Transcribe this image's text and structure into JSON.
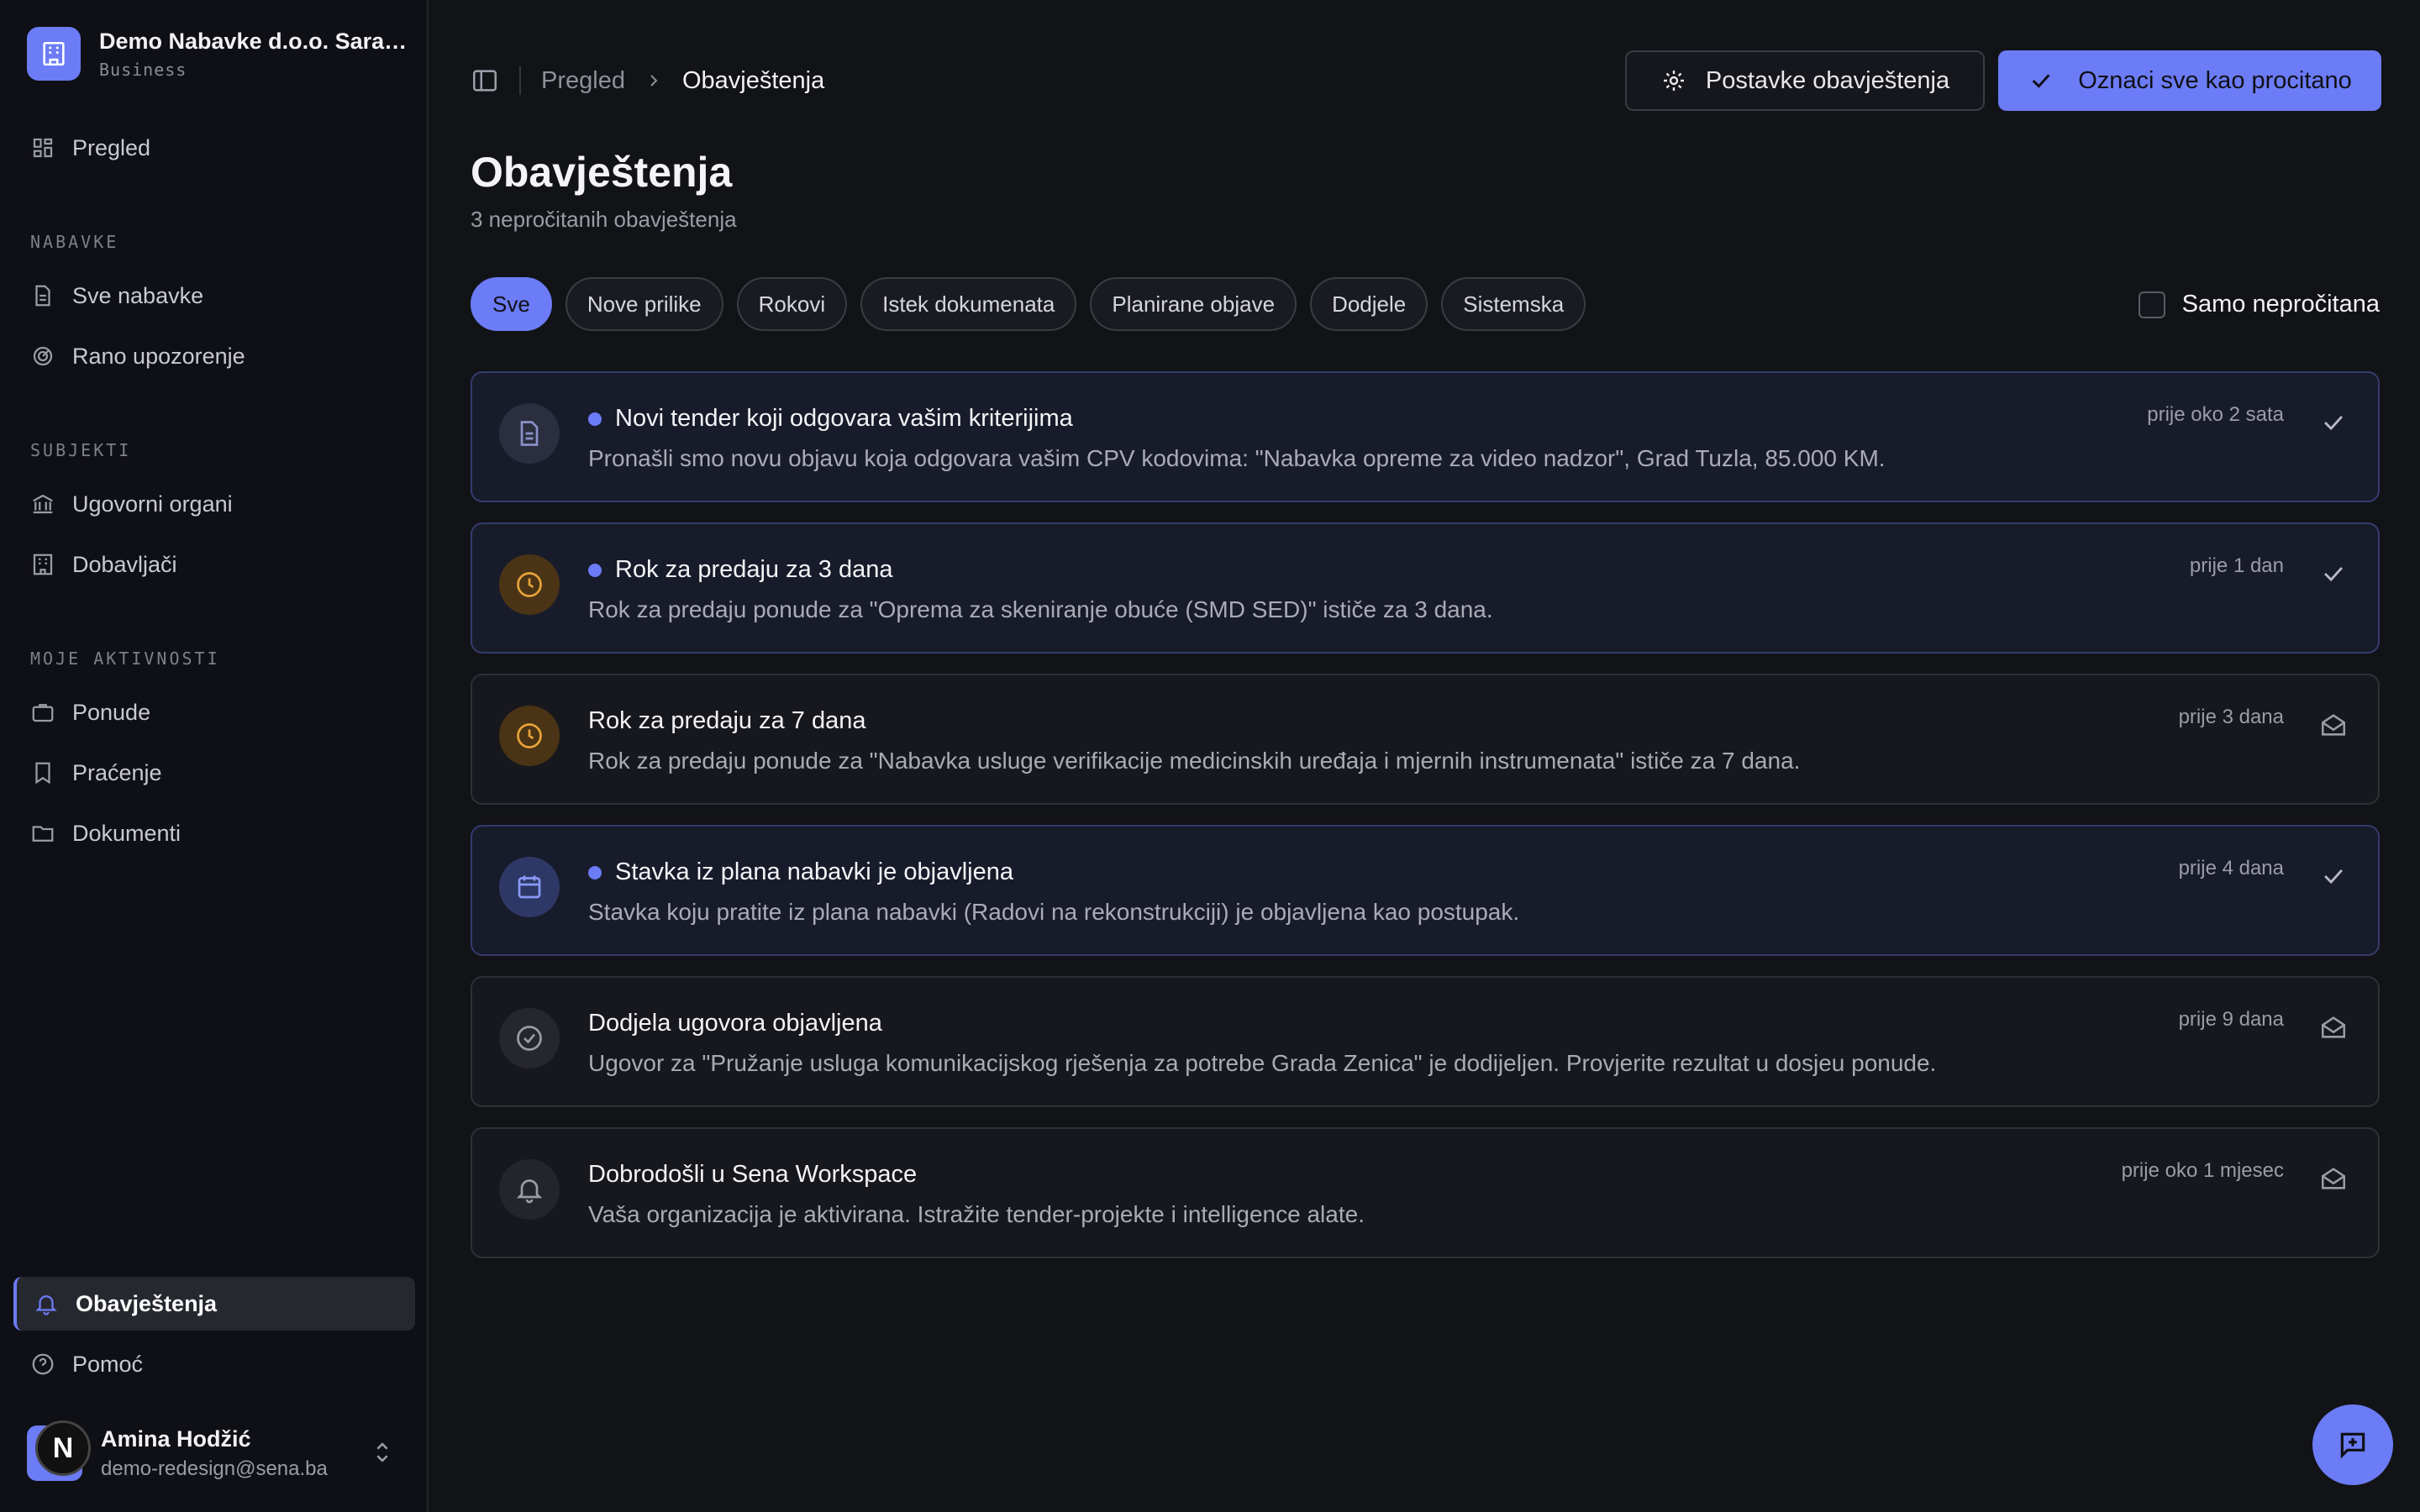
{
  "org": {
    "name": "Demo Nabavke d.o.o. Saraje...",
    "plan": "Business"
  },
  "sidebar": {
    "overview": "Pregled",
    "sections": {
      "nabavke": "NABAVKE",
      "subjekti": "SUBJEKTI",
      "aktivnosti": "MOJE AKTIVNOSTI"
    },
    "items": {
      "sve_nabavke": "Sve nabavke",
      "rano_upozorenje": "Rano upozorenje",
      "ugovorni_organi": "Ugovorni organi",
      "dobavljaci": "Dobavljači",
      "ponude": "Ponude",
      "pracenje": "Praćenje",
      "dokumenti": "Dokumenti",
      "obavjestenja": "Obavještenja",
      "pomoc": "Pomoć"
    }
  },
  "user": {
    "name": "Amina Hodžić",
    "email": "demo-redesign@sena.ba",
    "avatar_letter": "N"
  },
  "breadcrumb": {
    "parent": "Pregled",
    "current": "Obavještenja"
  },
  "actions": {
    "settings": "Postavke obavještenja",
    "mark_all": "Oznaci sve kao procitano"
  },
  "page": {
    "title": "Obavještenja",
    "subtitle": "3 nepročitanih obavještenja"
  },
  "filters": [
    "Sve",
    "Nove prilike",
    "Rokovi",
    "Istek dokumenata",
    "Planirane objave",
    "Dodjele",
    "Sistemska"
  ],
  "unread_only_label": "Samo nepročitana",
  "notifications": [
    {
      "title": "Novi tender koji odgovara vašim kriterijima",
      "body": "Pronašli smo novu objavu koja odgovara vašim CPV kodovima: \"Nabavka opreme za video nadzor\", Grad Tuzla, 85.000 KM.",
      "time": "prije oko 2 sata",
      "unread": true,
      "icon": "document-icon"
    },
    {
      "title": "Rok za predaju za 3 dana",
      "body": "Rok za predaju ponude za \"Oprema za skeniranje obuće (SMD SED)\" ističe za 3 dana.",
      "time": "prije 1 dan",
      "unread": true,
      "icon": "clock-icon"
    },
    {
      "title": "Rok za predaju za 7 dana",
      "body": "Rok za predaju ponude za \"Nabavka usluge verifikacije medicinskih uređaja i mjernih instrumenata\" ističe za 7 dana.",
      "time": "prije 3 dana",
      "unread": false,
      "icon": "clock-icon"
    },
    {
      "title": "Stavka iz plana nabavki je objavljena",
      "body": "Stavka koju pratite iz plana nabavki (Radovi na rekonstrukciji) je objavljena kao postupak.",
      "time": "prije 4 dana",
      "unread": true,
      "icon": "calendar-icon"
    },
    {
      "title": "Dodjela ugovora objavljena",
      "body": "Ugovor za \"Pružanje usluga komunikacijskog rješenja za potrebe Grada Zenica\" je dodijeljen. Provjerite rezultat u dosjeu ponude.",
      "time": "prije 9 dana",
      "unread": false,
      "icon": "badge-check-icon"
    },
    {
      "title": "Dobrodošli u Sena Workspace",
      "body": "Vaša organizacija je aktivirana. Istražite tender-projekte i intelligence alate.",
      "time": "prije oko 1 mjesec",
      "unread": false,
      "icon": "bell-icon"
    }
  ],
  "colors": {
    "accent": "#6c7cf6",
    "background": "#121317",
    "sidebar": "#0f1015",
    "warning_icon": "#e8a33a"
  }
}
